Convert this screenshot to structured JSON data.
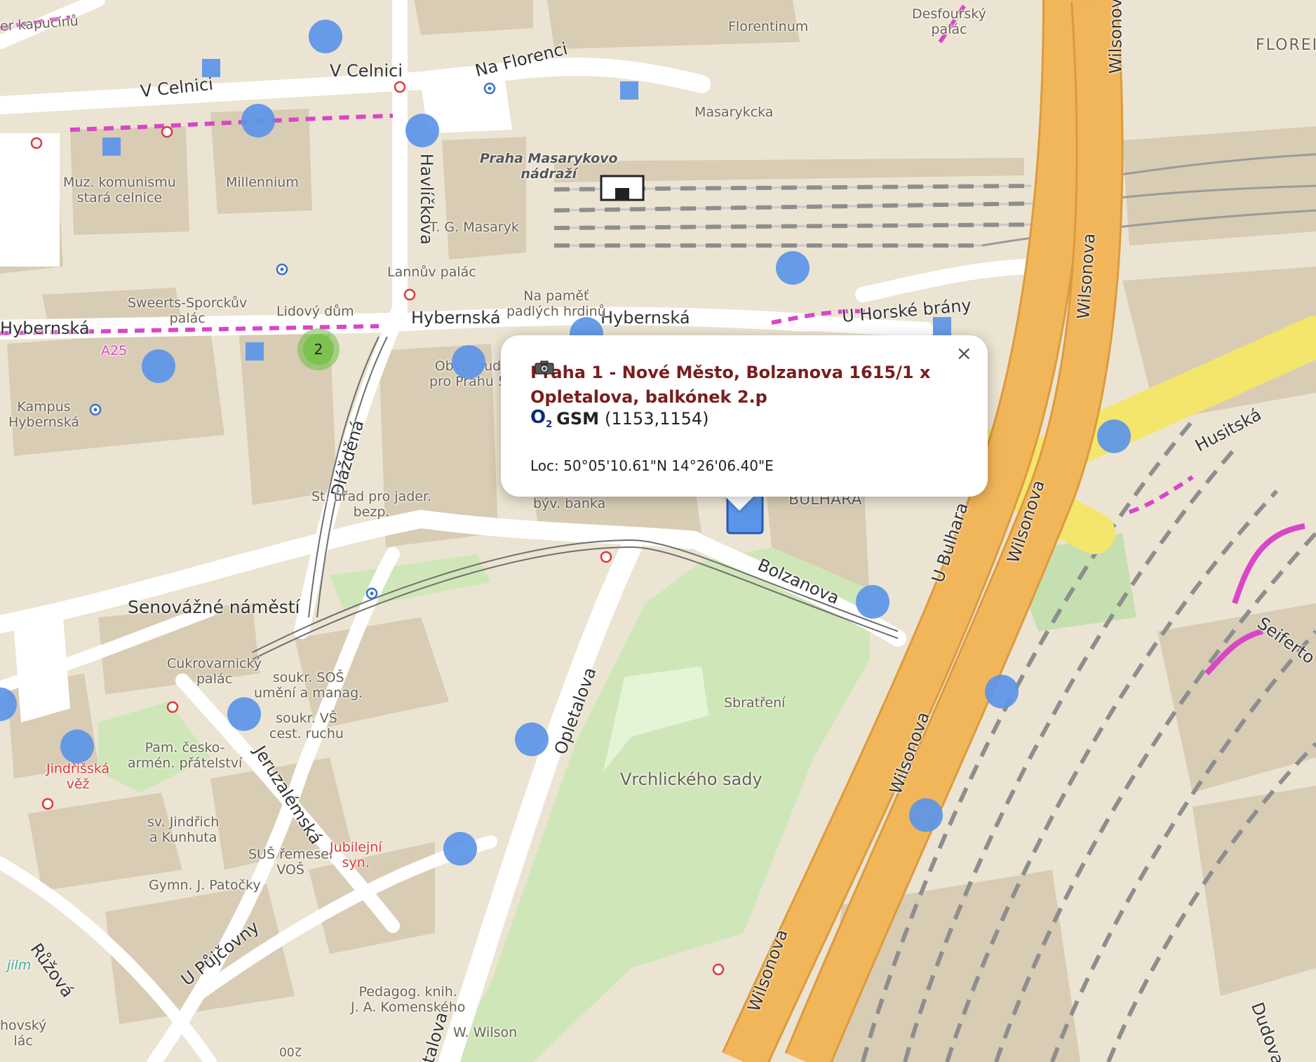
{
  "colors": {
    "land": "#ece4d2",
    "building": "#d8ccb4",
    "park": "#cfe7b8",
    "motorway": "#f2b65a",
    "primary": "#f4e66c",
    "rail": "#9a9a9a",
    "cycle": "#d946c8",
    "site_marker": "#5b95e8",
    "popup_title": "#7a1d1d",
    "operator": "#0b2c7a"
  },
  "map": {
    "streets": {
      "v_celnici_1": "V Celnici",
      "v_celnici_2": "V Celnici",
      "na_florenci": "Na Florenci",
      "havlickova": "Havlíčkova",
      "hybernska_1": "Hybernská",
      "hybernska_2": "Hybernská",
      "hybernska_3": "Hybernská",
      "u_horske_brany": "U Horské brány",
      "wilsonova_1": "Wilsonova",
      "wilsonova_2": "Wilsonova",
      "wilsonova_3": "Wilsonova",
      "wilsonova_4": "Wilsonova",
      "wilsonova_5": "Wilsonova",
      "husitska": "Husitská",
      "u_bulhara": "U Bulhara",
      "bolzanova": "Bolzanova",
      "dlazdena": "Dlážděná",
      "senovazne": "Senovážné náměstí",
      "opletalova": "Opletalova",
      "opletalova_2": "letalova",
      "jeruzalemska": "Jeruzalémská",
      "u_pujcovny": "U Půjčovny",
      "ruzova": "Růžová",
      "seifertova": "Seiferto",
      "dudova": "Dudova",
      "masarykcka": "Masarykcka",
      "florentinum": "Florentinum",
      "florenc": "FLOREI",
      "kapucinu": "er kapucínů",
      "a25": "A25"
    },
    "pois": {
      "muz_komunismu": "Muz. komunismu\nstará celnice",
      "millennium": "Millennium",
      "praha_masarykovo": "Praha Masarykovo\nnádraží",
      "tg_masaryk": "T. G. Masaryk",
      "lannuv_palac": "Lannův palác",
      "na_pamet": "Na paměť\npadlých hrdinů",
      "sweerts": "Sweerts-Sporckův\npalác",
      "lidovy_dum": "Lidový dům",
      "kampus": "Kampus\nHybernská",
      "obv_soud": "Obv. soud\npro Prahu 5",
      "st_urad": "St. úřad pro jader.\nbezp.",
      "byv_banka": "býv. banka",
      "bulhara": "BULHARA",
      "desfourskych": "Desfourský\npalác",
      "cukrovarnicky": "Cukrovarnický\npalác",
      "souk_sos": "soukr. SOŠ\numění a manag.",
      "souk_vs": "soukr. VŠ\ncest. ruchu",
      "jindrisska": "Jindřišská\nvěž",
      "pam_cesko": "Pam. česko-\narmén. přátelství",
      "sv_jindrich": "sv. Jindřich\na Kunhuta",
      "sus_remesel": "SUŠ řemesel\nVOŠ",
      "jubilejni": "Jubilejní\nsyn.",
      "gymn": "Gymn. J. Patočky",
      "sbratreni": "Sbratření",
      "vrchlickeho": "Vrchlického sady",
      "pedagog": "Pedagog. knih.\nJ. A. Komenského",
      "w_wilson": "W. Wilson",
      "jilm": "jilm",
      "hovsky": "hovský\nlác",
      "house200": "200"
    },
    "cluster_count": "2"
  },
  "popup": {
    "title": "Praha 1 - Nové Město, Bolzanova 1615/1 x Opletalova, balkónek 2.p",
    "operator_logo": "O",
    "operator_sub": "2",
    "network": "GSM",
    "cells": "(1153,1154)",
    "location": "Loc: 50°05'10.61\"N 14°26'06.40\"E",
    "close": "×",
    "camera_icon": "camera-icon"
  }
}
